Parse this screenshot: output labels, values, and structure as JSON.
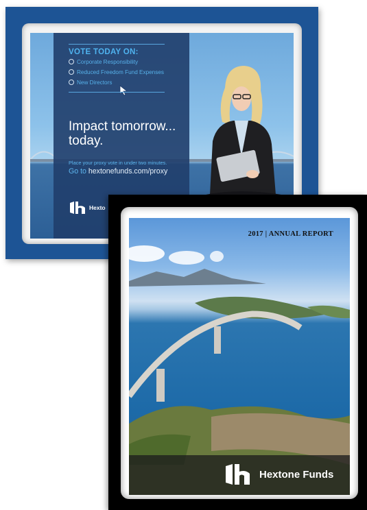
{
  "proxy_card": {
    "vote_heading": "VOTE TODAY ON:",
    "options": [
      "Corporate Responsibility",
      "Reduced Freedom Fund Expenses",
      "New Directors"
    ],
    "headline_line1": "Impact tomorrow...",
    "headline_line2": "today.",
    "instruction": "Place your proxy vote in under two minutes.",
    "go_to": "Go to",
    "url": "hextonefunds.com/proxy",
    "brand": "Hexto",
    "colors": {
      "background": "#1d5495",
      "panel": "#203e6c",
      "accent": "#4fb3ef"
    }
  },
  "annual_report": {
    "title": "2017 | ANNUAL REPORT",
    "brand": "Hextone Funds",
    "colors": {
      "background": "#000000",
      "bar": "#1e1e1e"
    }
  }
}
